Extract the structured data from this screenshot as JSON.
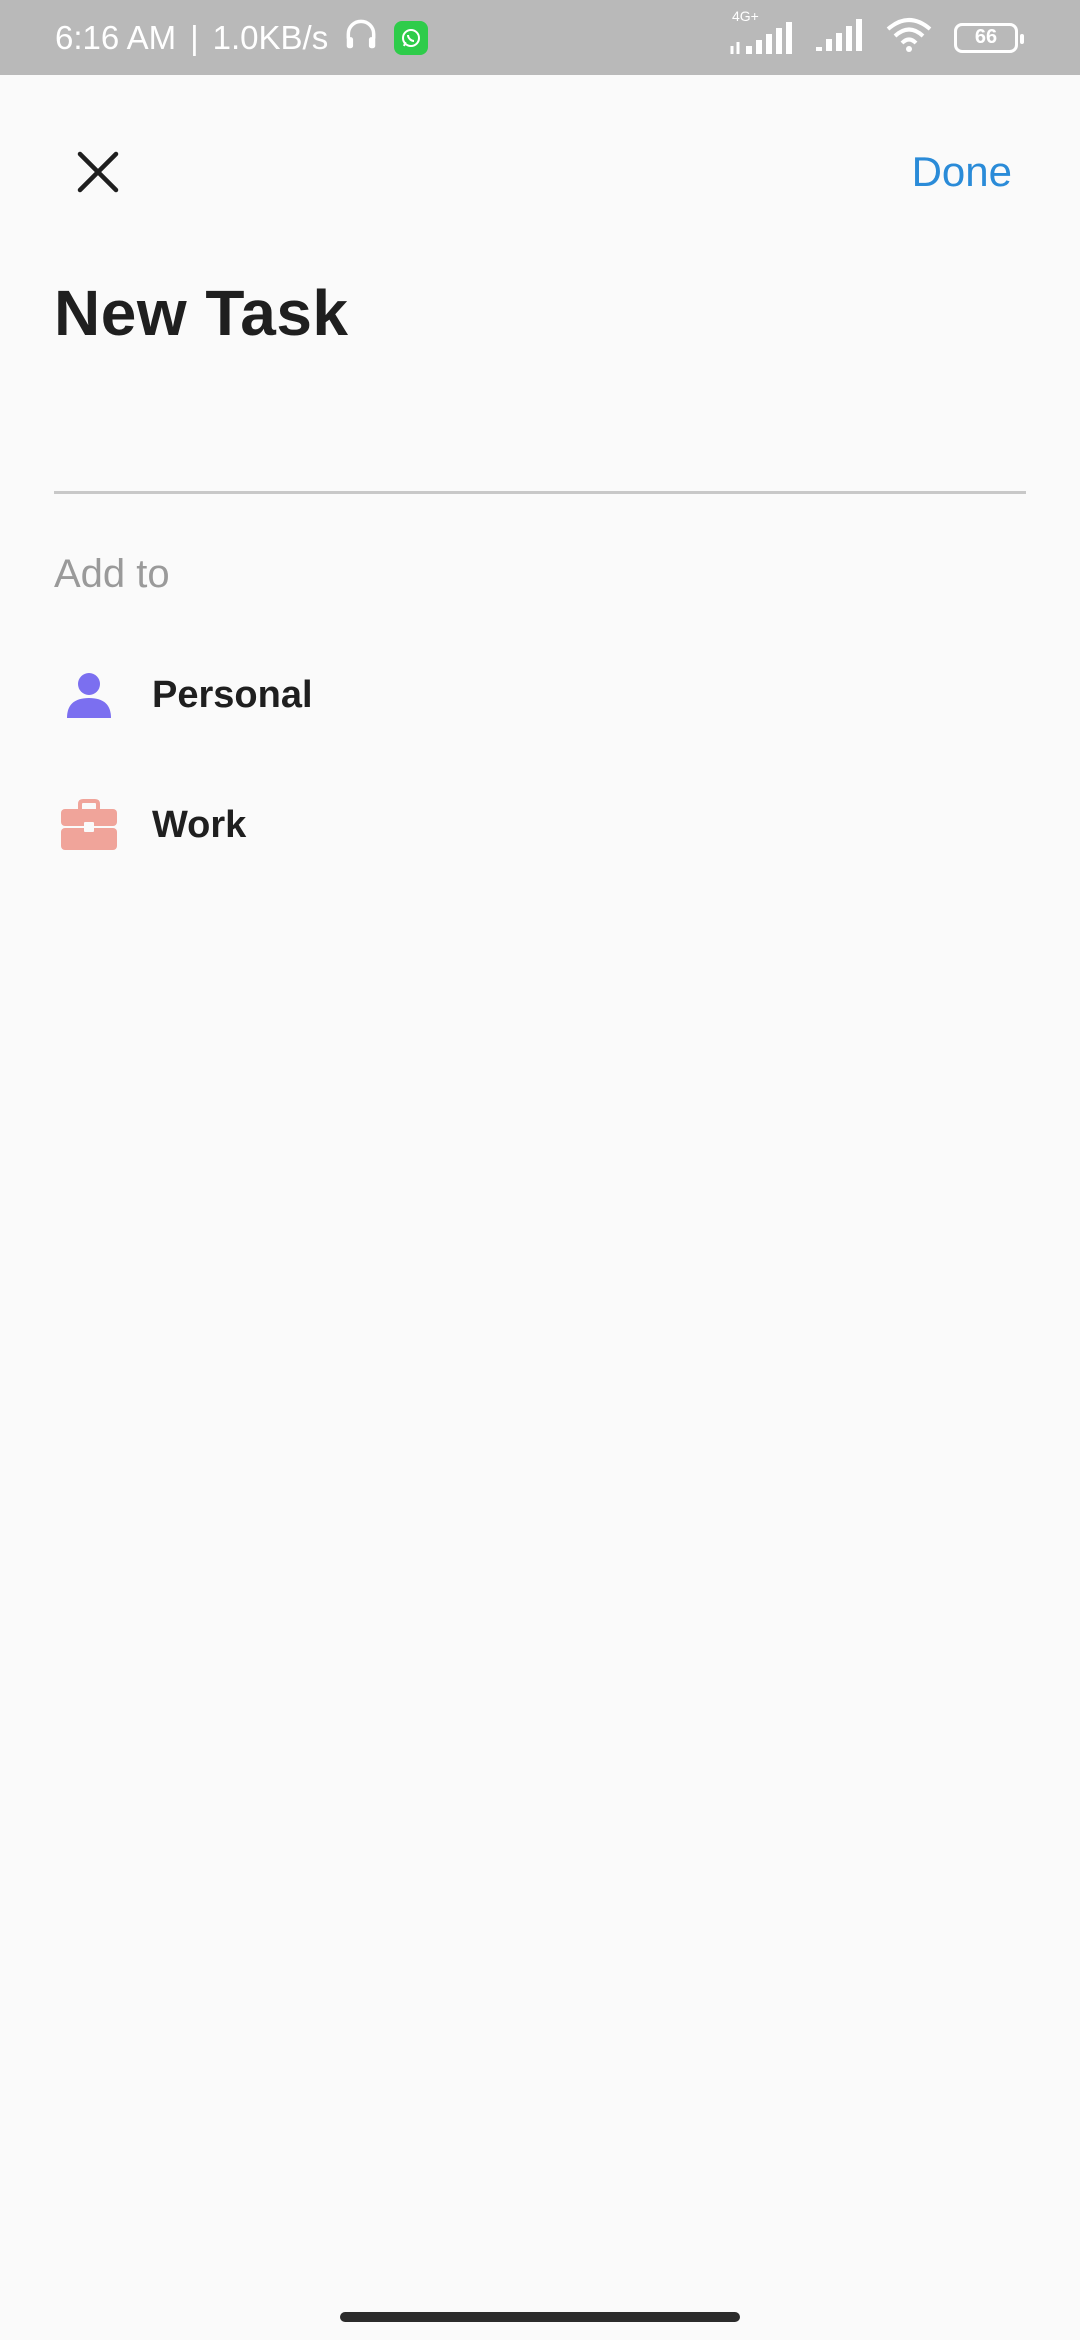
{
  "status_bar": {
    "time": "6:16 AM",
    "separator": "|",
    "speed": "1.0KB/s",
    "network_type": "4G+",
    "battery": "66",
    "icons": [
      "headphones-icon",
      "whatsapp-icon",
      "signal-icon",
      "signal-icon",
      "wifi-icon",
      "battery-icon"
    ]
  },
  "header": {
    "close_icon": "close-icon",
    "done_label": "Done"
  },
  "page": {
    "title": "New Task",
    "task_input": {
      "value": "",
      "placeholder": ""
    },
    "add_to_label": "Add to",
    "lists": [
      {
        "label": "Personal",
        "icon": "person-icon",
        "color": "#7b6ff0"
      },
      {
        "label": "Work",
        "icon": "briefcase-icon",
        "color": "#f0a49a"
      }
    ]
  },
  "colors": {
    "accent": "#2a8bd8",
    "status_bar": "#b9b9b9",
    "background": "#fafafa"
  }
}
